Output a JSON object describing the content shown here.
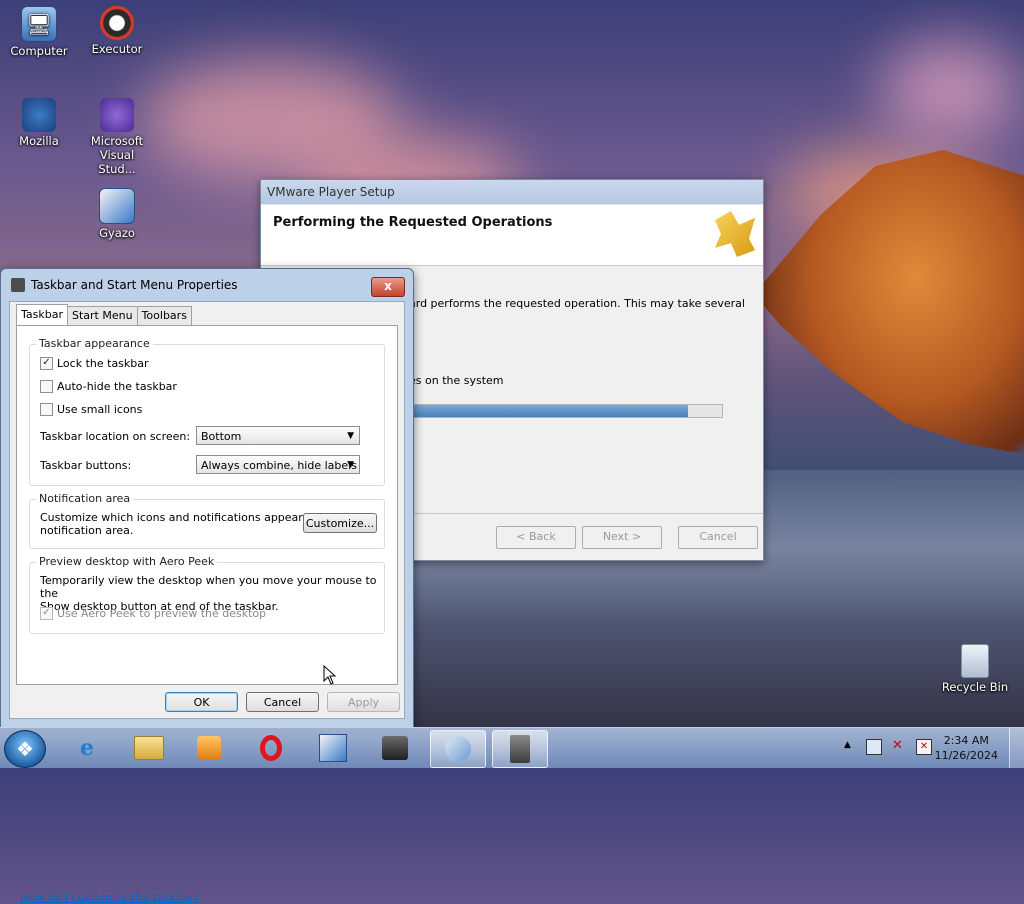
{
  "desktop": {
    "icons": [
      {
        "label": "Computer",
        "icon": "computer-icon"
      },
      {
        "label": "Executor",
        "icon": "executor-icon"
      },
      {
        "label": "Mozilla",
        "icon": "mozilla-icon"
      },
      {
        "label": "Microsoft Visual Stud...",
        "label_line1": "Microsoft",
        "label_line2": "Visual Stud...",
        "icon": "visual-studio-icon"
      },
      {
        "label": "Gyazo",
        "icon": "gyazo-icon"
      },
      {
        "label": "Recycle Bin",
        "icon": "recycle-bin-icon"
      }
    ]
  },
  "vmware": {
    "title": "VMware Player Setup",
    "header": "Performing the Requested Operations",
    "text1": "ard performs the requested operation. This may take several",
    "text2": "es on the system",
    "progress_fraction": 0.89,
    "back_label": "< Back",
    "next_label": "Next >",
    "cancel_label": "Cancel"
  },
  "taskbar_props": {
    "title": "Taskbar and Start Menu Properties",
    "close_glyph": "x",
    "tabs": [
      {
        "label": "Taskbar"
      },
      {
        "label": "Start Menu"
      },
      {
        "label": "Toolbars"
      }
    ],
    "appearance": {
      "group_title": "Taskbar appearance",
      "lock_label": "Lock the taskbar",
      "lock_checked": true,
      "autohide_label": "Auto-hide the taskbar",
      "autohide_checked": false,
      "small_icons_label": "Use small icons",
      "small_icons_checked": false,
      "location_label": "Taskbar location on screen:",
      "location_value": "Bottom",
      "buttons_label": "Taskbar buttons:",
      "buttons_value": "Always combine, hide labels"
    },
    "notification": {
      "group_title": "Notification area",
      "text_line1": "Customize which icons and notifications appear in the",
      "text_line2": "notification area.",
      "customize_label": "Customize..."
    },
    "aero_peek": {
      "group_title": "Preview desktop with Aero Peek",
      "text_line1": "Temporarily view the desktop when you move your mouse to the",
      "text_line2": "Show desktop button at end of the taskbar.",
      "checkbox_label": "Use Aero Peek to preview the desktop",
      "checked": true
    },
    "help_link": "How do I customize the taskbar?",
    "ok_label": "OK",
    "cancel_label": "Cancel",
    "apply_label": "Apply"
  },
  "taskbar": {
    "pinned": [
      {
        "icon": "internet-explorer-icon"
      },
      {
        "icon": "file-explorer-icon"
      },
      {
        "icon": "media-player-icon"
      },
      {
        "icon": "opera-icon"
      },
      {
        "icon": "gyazo-icon"
      },
      {
        "icon": "movie-maker-icon"
      },
      {
        "icon": "vmware-setup-icon"
      },
      {
        "icon": "taskbar-properties-icon"
      }
    ],
    "clock": {
      "time": "2:34 AM",
      "date": "11/26/2024"
    }
  },
  "colors": {
    "link": "#0066cc",
    "progress": "#4a7fb9",
    "close_button": "#c4442e"
  }
}
